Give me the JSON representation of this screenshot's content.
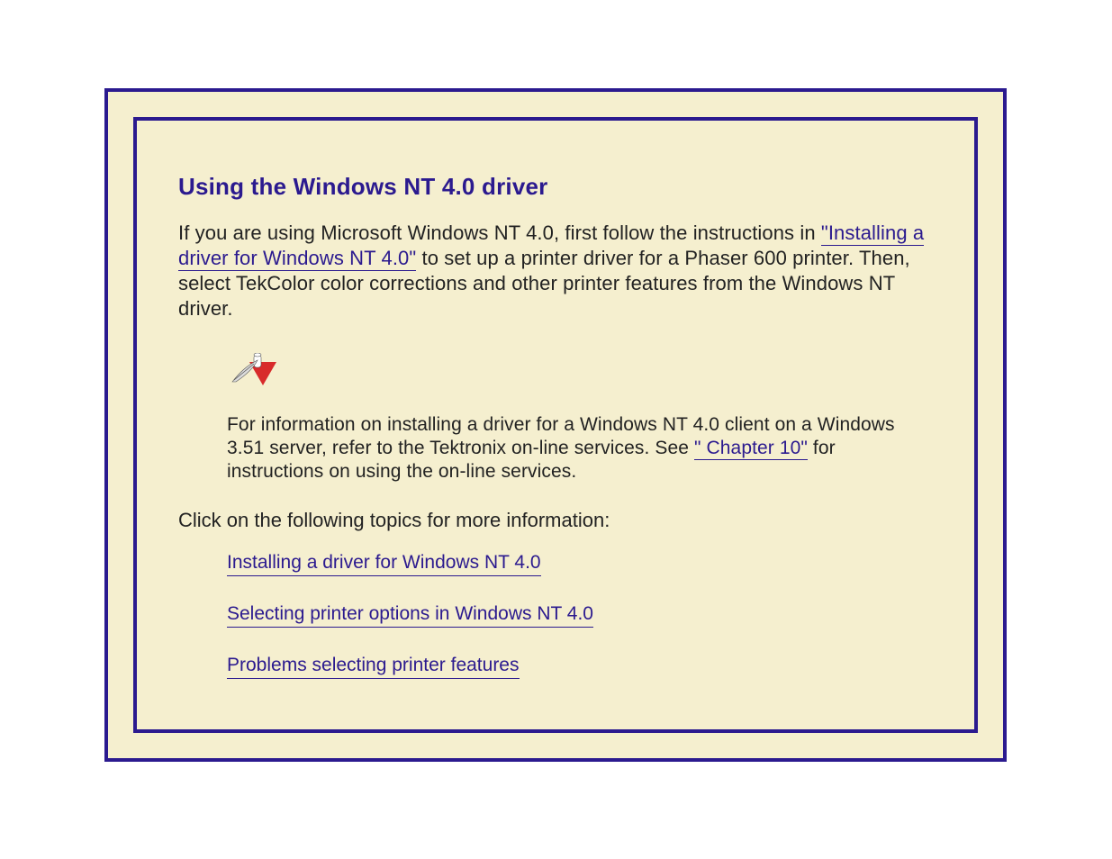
{
  "heading": "Using the Windows NT 4.0 driver",
  "para": {
    "pre": "If you are using Microsoft Windows NT 4.0, first follow the instructions in ",
    "link": "\"Installing a driver for Windows NT 4.0\"",
    "post": " to set up a printer driver for a Phaser 600 printer.  Then, select TekColor color corrections and other printer features from the Windows NT driver."
  },
  "note": {
    "pre": "For information on installing a driver for a Windows NT 4.0 client on a Windows 3.51 server, refer to the Tektronix on-line services.  See ",
    "link": "\" Chapter 10\"",
    "post": " for instructions on using the on-line services."
  },
  "topics_lead": "Click on the following topics for more information:",
  "topics": {
    "t1": "Installing a driver for Windows NT 4.0",
    "t2": "Selecting printer options in Windows NT 4.0",
    "t3": "Problems selecting printer features"
  }
}
